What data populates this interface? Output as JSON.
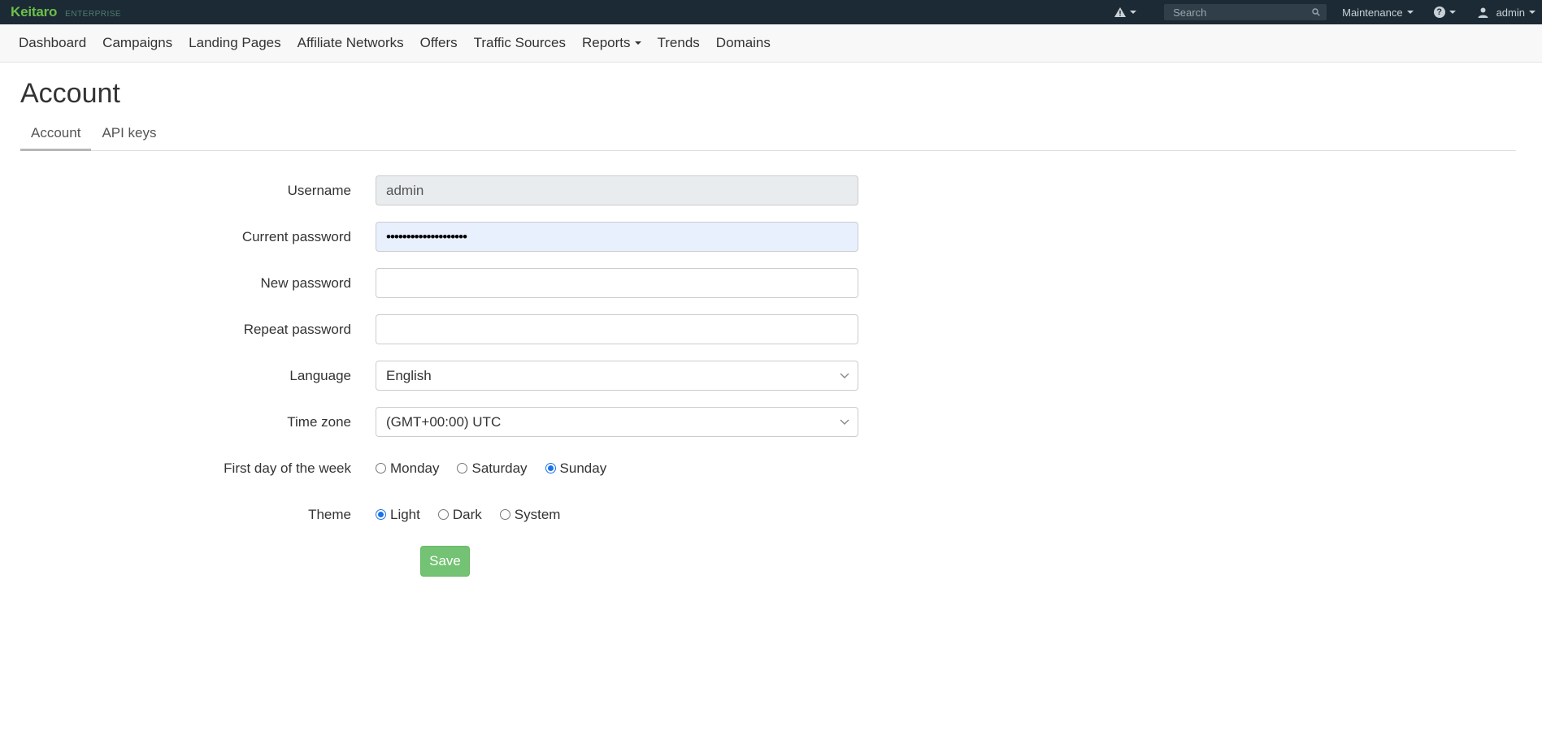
{
  "brand": {
    "name": "Keitaro",
    "edition": "ENTERPRISE"
  },
  "topbar": {
    "search_placeholder": "Search",
    "maintenance": "Maintenance",
    "user": "admin"
  },
  "nav": [
    {
      "label": "Dashboard"
    },
    {
      "label": "Campaigns"
    },
    {
      "label": "Landing Pages"
    },
    {
      "label": "Affiliate Networks"
    },
    {
      "label": "Offers"
    },
    {
      "label": "Traffic Sources"
    },
    {
      "label": "Reports"
    },
    {
      "label": "Trends"
    },
    {
      "label": "Domains"
    }
  ],
  "page": {
    "title": "Account"
  },
  "tabs": [
    {
      "label": "Account",
      "active": true
    },
    {
      "label": "API keys",
      "active": false
    }
  ],
  "form": {
    "username": {
      "label": "Username",
      "value": "admin"
    },
    "current_password": {
      "label": "Current password",
      "value": "••••••••••••••••••••"
    },
    "new_password": {
      "label": "New password",
      "value": ""
    },
    "repeat_password": {
      "label": "Repeat password",
      "value": ""
    },
    "language": {
      "label": "Language",
      "value": "English"
    },
    "timezone": {
      "label": "Time zone",
      "value": "(GMT+00:00) UTC"
    },
    "first_day": {
      "label": "First day of the week",
      "options": [
        "Monday",
        "Saturday",
        "Sunday"
      ],
      "selected": "Sunday"
    },
    "theme": {
      "label": "Theme",
      "options": [
        "Light",
        "Dark",
        "System"
      ],
      "selected": "Light"
    },
    "save_label": "Save"
  },
  "colors": {
    "topbar": "#1c2a35",
    "brand": "#6cc04a",
    "save": "#5cb85c",
    "radio_checked": "#1a73e8"
  },
  "icons": {
    "warning": "warning-icon",
    "search": "search-icon",
    "help": "help-icon",
    "user": "user-icon",
    "chevron": "chevron-down-icon"
  }
}
